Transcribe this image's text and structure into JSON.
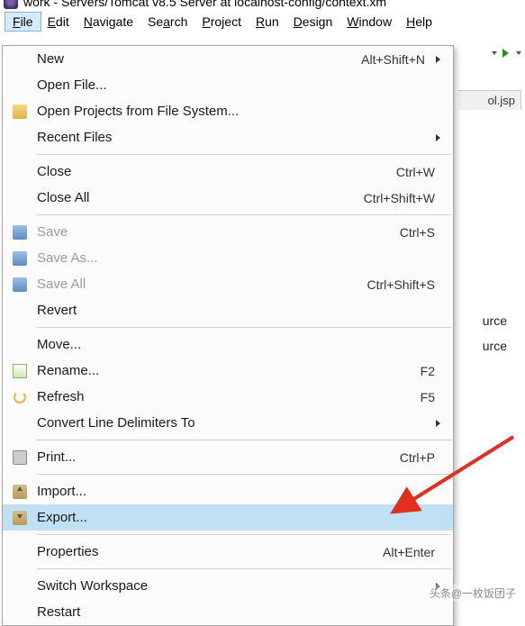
{
  "window": {
    "title": "work - Servers/Tomcat v8.5 Server at localhost-config/context.xm"
  },
  "menubar": {
    "items": [
      {
        "label": "File",
        "accel": "F",
        "open": true
      },
      {
        "label": "Edit",
        "accel": "E"
      },
      {
        "label": "Navigate",
        "accel": "N"
      },
      {
        "label": "Search",
        "accel": "a"
      },
      {
        "label": "Project",
        "accel": "P"
      },
      {
        "label": "Run",
        "accel": "R"
      },
      {
        "label": "Design",
        "accel": "D"
      },
      {
        "label": "Window",
        "accel": "W"
      },
      {
        "label": "Help",
        "accel": "H"
      }
    ]
  },
  "file_menu": {
    "groups": [
      [
        {
          "label": "New",
          "shortcut": "Alt+Shift+N",
          "submenu": true
        },
        {
          "label": "Open File..."
        },
        {
          "label": "Open Projects from File System...",
          "icon": "folder"
        },
        {
          "label": "Recent Files",
          "submenu": true
        }
      ],
      [
        {
          "label": "Close",
          "shortcut": "Ctrl+W"
        },
        {
          "label": "Close All",
          "shortcut": "Ctrl+Shift+W"
        }
      ],
      [
        {
          "label": "Save",
          "shortcut": "Ctrl+S",
          "icon": "save",
          "disabled": true
        },
        {
          "label": "Save As...",
          "disabled": true,
          "icon": "save"
        },
        {
          "label": "Save All",
          "shortcut": "Ctrl+Shift+S",
          "icon": "save",
          "disabled": true
        },
        {
          "label": "Revert"
        }
      ],
      [
        {
          "label": "Move..."
        },
        {
          "label": "Rename...",
          "shortcut": "F2",
          "icon": "rename"
        },
        {
          "label": "Refresh",
          "shortcut": "F5",
          "icon": "refresh"
        },
        {
          "label": "Convert Line Delimiters To",
          "submenu": true
        }
      ],
      [
        {
          "label": "Print...",
          "shortcut": "Ctrl+P",
          "icon": "print"
        }
      ],
      [
        {
          "label": "Import...",
          "icon": "import"
        },
        {
          "label": "Export...",
          "icon": "export",
          "highlight": true
        }
      ],
      [
        {
          "label": "Properties",
          "shortcut": "Alt+Enter"
        }
      ],
      [
        {
          "label": "Switch Workspace",
          "submenu": true
        },
        {
          "label": "Restart"
        }
      ]
    ]
  },
  "editor_remnant": {
    "tab_fragment": "ol.jsp",
    "source1": "urce",
    "source2": "urce"
  },
  "watermark": "头条@一枚饭团子"
}
